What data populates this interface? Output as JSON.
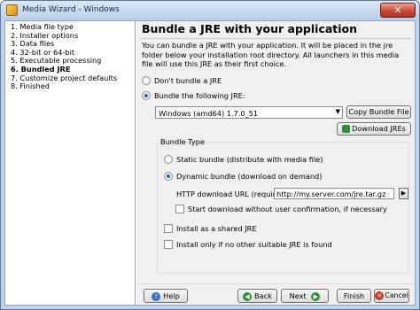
{
  "window": {
    "title": "Media Wizard - Windows",
    "close_glyph": "✕"
  },
  "sidebar": {
    "steps": [
      "1. Media file type",
      "2. Installer options",
      "3. Data files",
      "4. 32-bit or 64-bit",
      "5. Executable processing",
      "6. Bundled JRE",
      "7. Customize project defaults",
      "8. Finished"
    ],
    "active_index": 5
  },
  "main": {
    "heading": "Bundle a JRE with your application",
    "description": "You can bundle a JRE with your application. It will be placed in the jre folder below your installation root directory. All launchers in this media file will use this JRE as their first choice.",
    "option_no_jre": "Don't bundle a JRE",
    "option_bundle": "Bundle the following JRE:",
    "jre_selected": "Windows (amd64) 1.7.0_51",
    "copy_bundle_label": "Copy Bundle File",
    "download_jres_label": "Download JREs",
    "bundle_type": {
      "title": "Bundle Type",
      "static_label": "Static bundle (distribute with media file)",
      "dynamic_label": "Dynamic bundle (download on demand)",
      "url_label": "HTTP download URL (required):",
      "url_value": "http://my.server.com/jre.tar.gz",
      "start_download_label": "Start download without user confirmation, if necessary"
    },
    "shared_jre_label": "Install as a shared JRE",
    "only_if_none_label": "Install only if no other suitable JRE is found"
  },
  "footer": {
    "help_label": "Help",
    "back_label": "Back",
    "next_label": "Next",
    "finish_label": "Finish",
    "cancel_label": "Cancel"
  },
  "colors": {
    "accent": "#2b5db1",
    "frame": "#bfd3ea",
    "close": "#c74a36"
  }
}
